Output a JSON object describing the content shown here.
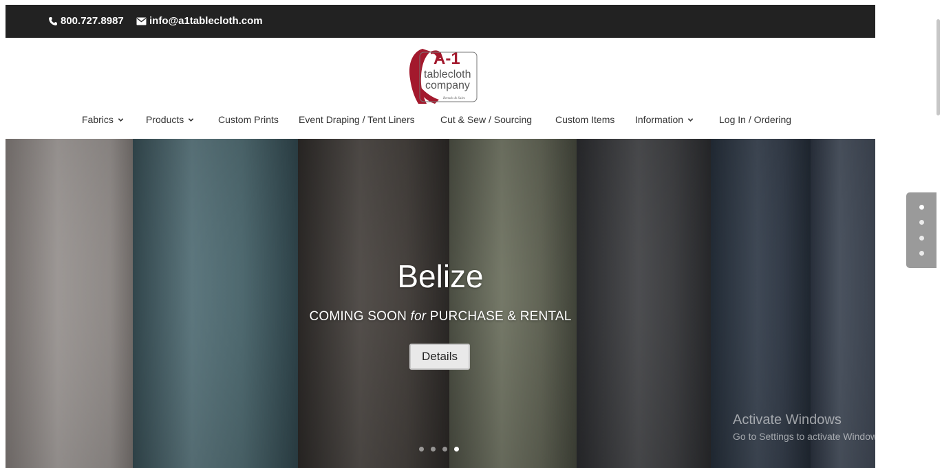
{
  "topbar": {
    "phone": "800.727.8987",
    "email": "info@a1tablecloth.com"
  },
  "logo": {
    "line1": "A-1",
    "line2": "tablecloth",
    "line3": "company",
    "line4": "Rentals & Sales"
  },
  "nav": {
    "items": [
      {
        "label": "Fabrics",
        "dropdown": true
      },
      {
        "label": "Products",
        "dropdown": true
      },
      {
        "label": "Custom Prints",
        "dropdown": false
      },
      {
        "label": "Event Draping / Tent Liners",
        "dropdown": false
      },
      {
        "label": "Cut & Sew / Sourcing",
        "dropdown": false
      },
      {
        "label": "Custom Items",
        "dropdown": false
      },
      {
        "label": "Information",
        "dropdown": true
      },
      {
        "label": "Log In / Ordering",
        "dropdown": false
      }
    ]
  },
  "hero": {
    "title": "Belize",
    "subtitle_pre": "COMING SOON ",
    "subtitle_em": "for",
    "subtitle_post": " PURCHASE & RENTAL",
    "button_label": "Details",
    "slide_count": 4,
    "active_slide": 4
  },
  "side_nav": {
    "count": 4,
    "active": 1
  },
  "watermark": {
    "title": "Activate Windows",
    "subtitle": "Go to Settings to activate Windows."
  },
  "colors": {
    "topbar": "#222222",
    "brand_red": "#a3192d",
    "nav_text": "#333333"
  }
}
